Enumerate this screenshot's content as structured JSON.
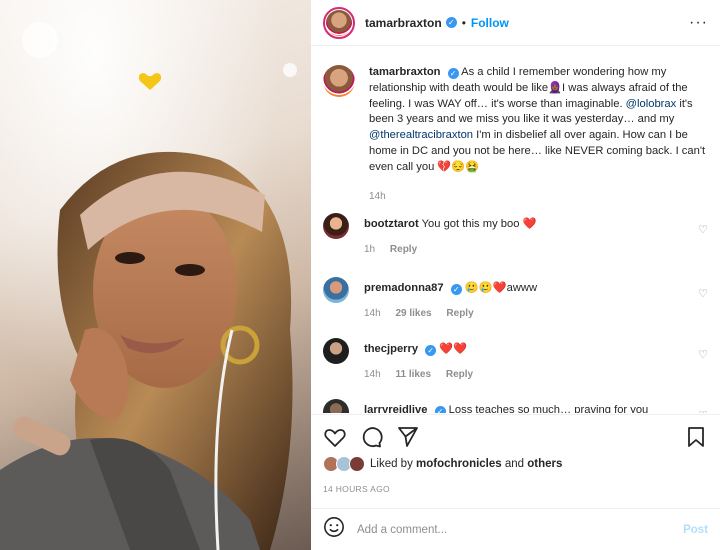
{
  "post": {
    "username": "tamarbraxton",
    "follow_label": "Follow",
    "more_icon": "more-options-icon",
    "caption": {
      "username": "tamarbraxton",
      "text_1": "As a child I remember wondering how my relationship with death would be like",
      "emoji_1": "🧕🏾",
      "text_2": "I was always afraid of the feeling. I was WAY off… it's worse than imaginable.",
      "mention_1": "@lolobrax",
      "text_3": "it's been 3 years and we miss you like it was yesterday… and my",
      "mention_2": "@therealtracibraxton",
      "text_4": "I'm in disbelief all over again. How can I be home in DC and you not be here… like NEVER coming back. I can't even call you",
      "emoji_end": "💔😔🤮",
      "time": "14h"
    },
    "comments": [
      {
        "username": "bootztarot",
        "verified": false,
        "text": "You got this my boo",
        "emoji": "❤️",
        "time": "1h",
        "likes": "",
        "reply": "Reply"
      },
      {
        "username": "premadonna87",
        "verified": true,
        "text": "awww",
        "emoji": "🥲🥲❤️",
        "time": "14h",
        "likes": "29 likes",
        "reply": "Reply"
      },
      {
        "username": "thecjperry",
        "verified": true,
        "text": "",
        "emoji": "❤️❤️",
        "time": "14h",
        "likes": "11 likes",
        "reply": "Reply"
      },
      {
        "username": "larryreidlive",
        "verified": true,
        "text": "Loss teaches so much… praving for you",
        "emoji": "",
        "time": "",
        "likes": "",
        "reply": ""
      }
    ],
    "liked_by_prefix": "Liked by",
    "liked_by_user": "mofochronicles",
    "liked_by_and": "and",
    "liked_by_others": "others",
    "time_ago": "14 HOURS AGO",
    "add_comment_placeholder": "Add a comment...",
    "post_label": "Post"
  },
  "colors": {
    "link_blue": "#0095f6",
    "mention": "#00376b",
    "heart_red": "#ed1c24",
    "muted": "#8e8e8e",
    "post_disabled": "#b2dffc"
  }
}
